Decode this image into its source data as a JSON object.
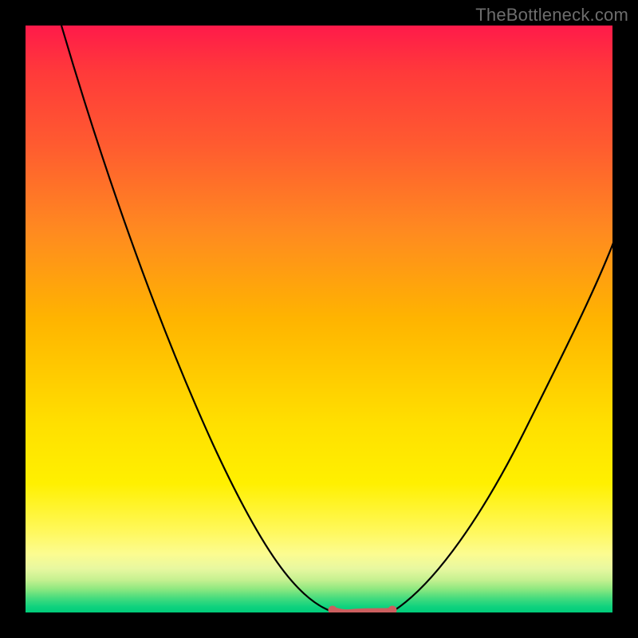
{
  "watermark": {
    "text": "TheBottleneck.com"
  },
  "colors": {
    "frame": "#000000",
    "curve": "#000000",
    "optimal_band": "#cc5f5f",
    "gradient_top": "#ff1a4a",
    "gradient_bottom": "#00cc7a"
  },
  "chart_data": {
    "type": "line",
    "title": "",
    "xlabel": "",
    "ylabel": "",
    "xlim": [
      0,
      100
    ],
    "ylim": [
      0,
      100
    ],
    "grid": false,
    "legend": false,
    "annotations": [],
    "series": [
      {
        "name": "left-curve",
        "x": [
          6,
          10,
          15,
          20,
          25,
          30,
          35,
          40,
          45,
          50,
          52.5
        ],
        "values": [
          100,
          92,
          82,
          72,
          61,
          50,
          39,
          28,
          17,
          5,
          0
        ]
      },
      {
        "name": "right-curve",
        "x": [
          62.5,
          65,
          70,
          75,
          80,
          85,
          90,
          95,
          100
        ],
        "values": [
          0,
          3,
          11,
          20,
          29,
          38,
          47,
          56,
          64
        ]
      },
      {
        "name": "optimal-band",
        "x": [
          52.5,
          55,
          57.5,
          60,
          62.5
        ],
        "values": [
          0,
          0,
          0,
          0,
          0
        ]
      }
    ],
    "optimal_range": {
      "start_x": 52.5,
      "end_x": 62.5,
      "y": 0
    }
  }
}
